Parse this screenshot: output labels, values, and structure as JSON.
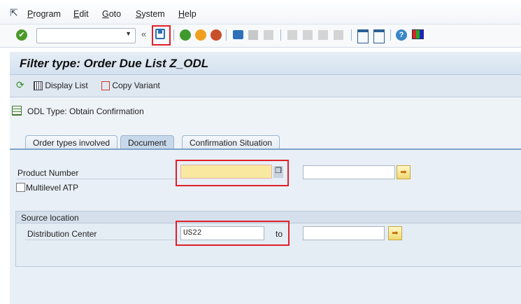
{
  "menu": {
    "items": [
      "Program",
      "Edit",
      "Goto",
      "System",
      "Help"
    ]
  },
  "toolbar": {
    "command_value": ""
  },
  "title": "Filter type: Order Due List Z_ODL",
  "app_toolbar": {
    "display_list": "Display List",
    "copy_variant": "Copy Variant"
  },
  "odl_type": "ODL Type: Obtain Confirmation",
  "tabs": [
    "Order types involved",
    "Document",
    "Confirmation Situation"
  ],
  "active_tab": "Document",
  "form": {
    "product_number_label": "Product Number",
    "product_from": "",
    "product_to": "",
    "multilevel_label": "Multilevel ATP",
    "multilevel_checked": false,
    "group_title": "Source location",
    "dc_label": "Distribution Center",
    "dc_from": "US22",
    "to_label": "to",
    "dc_to": ""
  },
  "colors": {
    "highlight": "#e0202a",
    "required_field": "#f8e8a0"
  }
}
